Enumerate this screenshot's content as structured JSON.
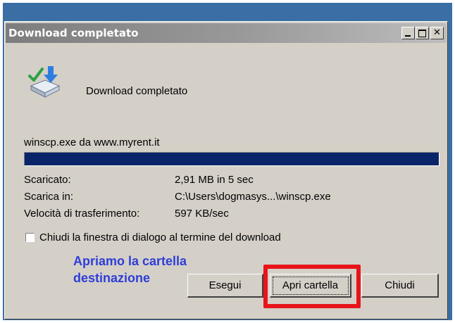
{
  "window": {
    "title": "Download completato",
    "title_bar_buttons": [
      "minimize",
      "maximize",
      "close"
    ],
    "close_glyph": "✕"
  },
  "main": {
    "icon": "download-complete-icon",
    "heading": "Download completato",
    "source": "winscp.exe da www.myrent.it",
    "progress": 1.0,
    "info": [
      {
        "label": "Scaricato:",
        "value": "2,91 MB in 5 sec"
      },
      {
        "label": "Scarica in:",
        "value": "C:\\Users\\dogmasys...\\winscp.exe"
      },
      {
        "label": "Velocità di trasferimento:",
        "value": "597 KB/sec"
      }
    ],
    "close_checkbox": {
      "label": "Chiudi la finestra di dialogo al termine del download",
      "checked": false
    }
  },
  "annotation": {
    "text": "Apriamo la cartella destinazione",
    "color": "#2f3dd8",
    "highlight_color": "#e8141a"
  },
  "buttons": {
    "run": "Esegui",
    "open_folder": "Apri cartella",
    "close": "Chiudi"
  },
  "colors": {
    "progress_fill": "#0a246a",
    "face": "#d4d0c8",
    "desktop": "#3a6ea5"
  }
}
